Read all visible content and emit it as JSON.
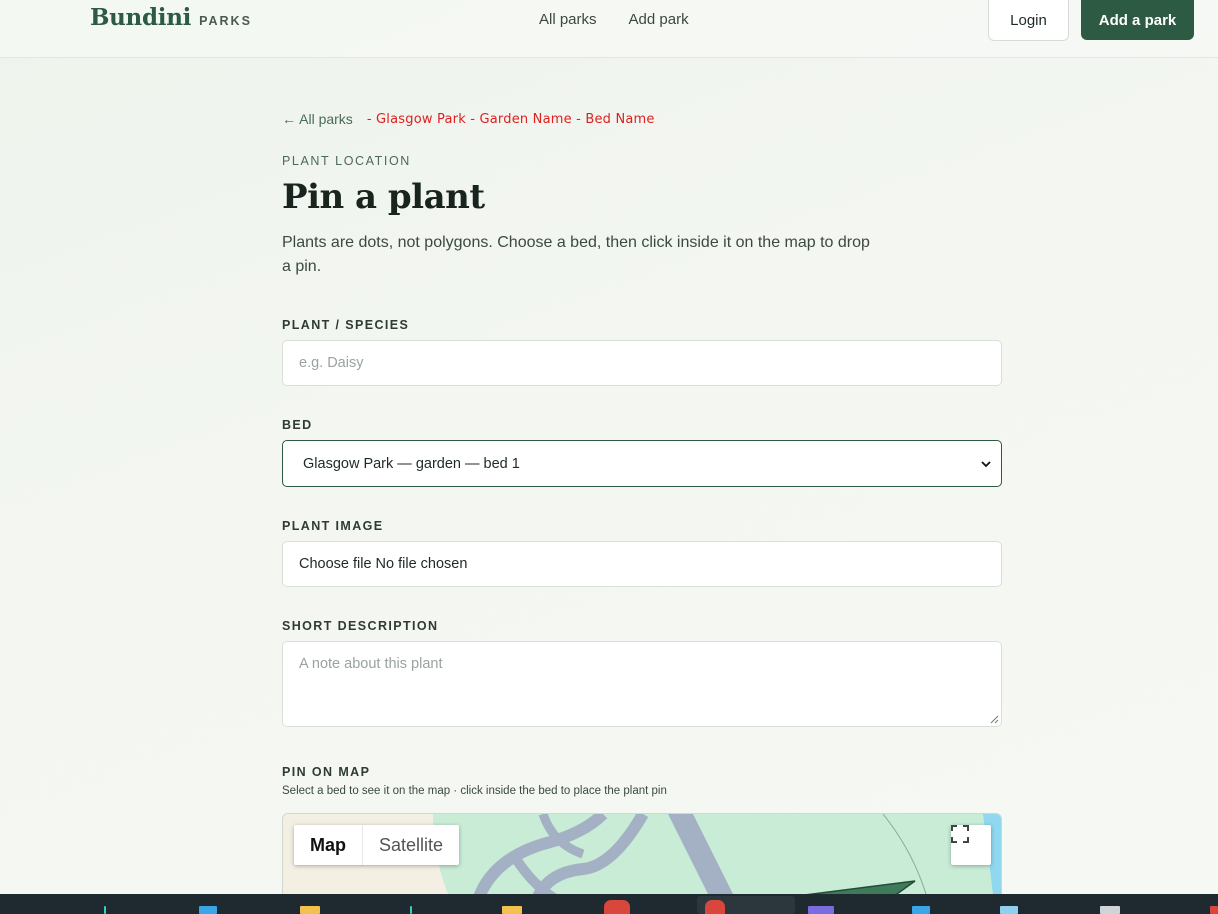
{
  "header": {
    "logo_name": "Bundini",
    "logo_sub": "PARKS",
    "nav": [
      "All parks",
      "Add park"
    ],
    "login_label": "Login",
    "add_park_label": "Add a park"
  },
  "breadcrumb": {
    "back_label": "← All parks",
    "path": "- Glasgow Park - Garden Name - Bed Name"
  },
  "page": {
    "eyebrow": "PLANT LOCATION",
    "title": "Pin a plant",
    "intro": "Plants are dots, not polygons. Choose a bed, then click inside it on the map to drop a pin."
  },
  "form": {
    "species_label": "PLANT / SPECIES",
    "species_placeholder": "e.g. Daisy",
    "bed_label": "BED",
    "bed_selected": "Glasgow Park — garden — bed 1",
    "image_label": "PLANT IMAGE",
    "image_button": "Choose file",
    "image_status": "No file chosen",
    "description_label": "SHORT DESCRIPTION",
    "description_placeholder": "A note about this plant",
    "map_label": "PIN ON MAP",
    "map_hint": "Select a bed to see it on the map · click inside the bed to place the plant pin"
  },
  "map": {
    "type_map": "Map",
    "type_satellite": "Satellite",
    "colors": {
      "land": "#f4efe3",
      "park": "#c8ecd6",
      "road": "#a4b1c4",
      "water": "#8fd8f0",
      "bed": "#3f7a5a"
    }
  },
  "colors": {
    "accent": "#2d5a43",
    "breadcrumb_path": "#e02020"
  }
}
